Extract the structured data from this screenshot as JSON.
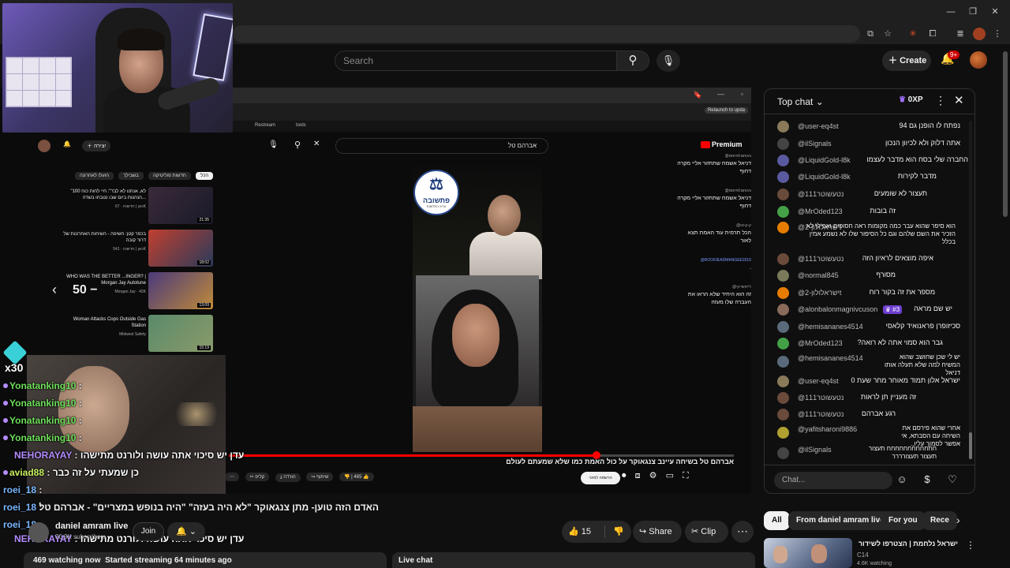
{
  "header": {
    "search_placeholder": "Search",
    "create_label": "Create",
    "notif_count": "9+"
  },
  "inner_screen": {
    "bookmarks": [
      "Restream",
      "tools"
    ],
    "relaunch_label": "Relaunch to upda",
    "search_query": "אברהם טל",
    "premium_label": "Premium",
    "create_label": "יצירה",
    "chips": [
      "הכל",
      "חדשות פוליטיקה",
      "בשבילך",
      "הועלו לאחרונה"
    ],
    "recommendations": [
      {
        "title": "\"לא, אנחנו לא לבד\": חיי לחות כוח 100 הנהגות ביום שבו נטבחו בשדה...",
        "meta": "כאן | חדשות",
        "views": "67K",
        "duration": "21:35"
      },
      {
        "title": "בכפר קטן: חשיפה - השיחות האחרונות של דרור קובה",
        "meta": "כאן | חדשות",
        "views": "541K",
        "duration": "18:02"
      },
      {
        "title": "WHO WAS THE BETTER ...INGER? | Morgan Jay Autotune",
        "meta": "Morgan Jay",
        "views": "42K",
        "duration": "13:09"
      },
      {
        "title": "Woman Attacks Cops Outside Gas Station",
        "meta": "Midwest Safety",
        "views": "",
        "duration": "15:19"
      }
    ],
    "seek_label": "50 −",
    "logo_text": "פתשובה",
    "logo_subtext": "ערוץ החדשות",
    "live_chat": [
      {
        "author": "@גיגוחגולפיוסמ",
        "text": "דניאל אשמח שתחזור אליי מקרה דחוף"
      },
      {
        "author": "@גיגוחגולפיוסמ",
        "text": "דניאל אשמח שתחזור אליי מקרה דחוף"
      },
      {
        "author": "@ק-ק-טו",
        "text": "הכל תרמית עוד האמת תצא לאור"
      },
      {
        "author": "@ROOKIEADMANGEE2016",
        "text": "."
      },
      {
        "author": "@לייסשייקי",
        "text": "זה הוא היחיד שלא הראו את העברה שלו מעזה"
      }
    ],
    "video_title": "אברהם טל בשיחה עיינב צנגאוקר על כול האמת כמו שלא שמעתם לעולם",
    "like_count": "465",
    "actions": [
      "שיתוף",
      "הורדה",
      "קליפ"
    ],
    "subscribe_label": "הרשמה למינוי"
  },
  "overlay": {
    "multiplier": "x30",
    "chat": [
      {
        "name": "Yonatanking10",
        "text": "",
        "color": "green"
      },
      {
        "name": "Yonatanking10",
        "text": "",
        "color": "green"
      },
      {
        "name": "Yonatanking10",
        "text": "",
        "color": "green"
      },
      {
        "name": "Yonatanking10",
        "text": "",
        "color": "green"
      },
      {
        "name": "NEHORAYAY",
        "text": "עדן יש סיכוי אתה עושה ולורנט מתישהו",
        "color": "purple"
      },
      {
        "name": "aviad88",
        "text": "כן שמעתי על זה כבר",
        "color": "lime"
      },
      {
        "name": "roei_18",
        "text": "",
        "color": "blue"
      },
      {
        "name": "roei_18",
        "text": "",
        "color": "blue"
      },
      {
        "name": "roei_18",
        "text": "",
        "color": "blue"
      },
      {
        "name": "NEHORAYAY",
        "text": "עדן יש סיכוי אתה עושה ולורנט מתישהו",
        "color": "purple"
      }
    ]
  },
  "video": {
    "title": "האדם הזה טוען- מתן צנגאוקר \"לא היה בעזה\" \"היה בנופש במצריים\" - אברהם טל",
    "channel_name": "daniel amram live",
    "subscribers": "30.9K subscribers",
    "join_label": "Join",
    "likes": "15",
    "share_label": "Share",
    "clip_label": "Clip",
    "watching": "469 watching now",
    "started": "Started streaming 64 minutes ago",
    "live_chat_tab": "Live chat"
  },
  "chat_panel": {
    "mode_label": "Top chat",
    "xp_label": "0XP",
    "input_placeholder": "Chat...",
    "messages": [
      {
        "author": "@user-eq4st",
        "text": "נפתח לו הופנן גם 94",
        "avatar_color": "#8a7a5a"
      },
      {
        "author": "@ilSignals",
        "text": "אתה דלוק ולא לכיוון הנכון",
        "avatar_color": "#444444"
      },
      {
        "author": "@LiquidGold-l8k",
        "text": "החברה שלי בסח הוא מדבר לעצמו",
        "avatar_color": "#5a5aa0"
      },
      {
        "author": "@LiquidGold-l8k",
        "text": "מדבר לקירות",
        "avatar_color": "#5a5aa0"
      },
      {
        "author": "@נטעשוטר111",
        "text": "תעצור לא שומעים",
        "avatar_color": "#6a4a3a"
      },
      {
        "author": "@MrOded123",
        "text": "זה בובות",
        "avatar_color": "#43a047"
      },
      {
        "author": "@ישראלולון-2t",
        "text": "הוא סיפר שהוא עבר כמה מקומות ראה חסופים ואפילו לא הזכיר את השם שלהם וגם כל הסיפור שלו לא נשמע אמין בכלל",
        "avatar_color": "#e67c00"
      },
      {
        "author": "@נטעשוטר111",
        "text": "איפה מוצאים לראיון הזה",
        "avatar_color": "#6a4a3a"
      },
      {
        "author": "@normal845",
        "text": "מסורף",
        "avatar_color": "#7a7a5a"
      },
      {
        "author": "@ישראלולון-2t",
        "text": "מספר את זה בקור רוח",
        "avatar_color": "#e67c00"
      },
      {
        "author": "@alonbalonmagnivcuson",
        "text": "יש שם מראה",
        "avatar_color": "#8a6a5a",
        "badge": "#3"
      },
      {
        "author": "@hemisananes4514",
        "text": "סכיזופרן פראנואיד קלאסי",
        "avatar_color": "#5a6a7a"
      },
      {
        "author": "@MrOded123",
        "text": "גבר הוא סמוי אתה לא רואה?",
        "avatar_color": "#43a047"
      },
      {
        "author": "@hemisananes4514",
        "text": "יש לי שכן שחושב שהוא המשיח למה שלא תעלה אותו דניאל",
        "avatar_color": "#5a6a7a"
      },
      {
        "author": "@user-eq4st",
        "text": "ישראל אלון תמוד מאוחר מחר שעת 0",
        "avatar_color": "#8a7a5a"
      },
      {
        "author": "@נטעשוטר111",
        "text": "זה מעניין תן לראות",
        "avatar_color": "#6a4a3a"
      },
      {
        "author": "@נטעשוטר111",
        "text": "רגע אברהם",
        "avatar_color": "#6a4a3a"
      },
      {
        "author": "@yafitsharoni9886",
        "text": "אחרי שהוא פירסם את השיחה עם הסבתא, אי אפשר לסמוך עליו..",
        "avatar_color": "#b0a030"
      },
      {
        "author": "@ilSignals",
        "text": "חחחחחחחחחחחח תעצור תעצור תעצורררר",
        "avatar_color": "#444444"
      }
    ]
  },
  "feed": {
    "chips": [
      "All",
      "From daniel amram live",
      "For you",
      "Rece"
    ],
    "side_video": {
      "title": "ישראל נלחמת | הצטרפו לשידור החי",
      "channel": "C14",
      "views": "4.6K watching"
    }
  }
}
